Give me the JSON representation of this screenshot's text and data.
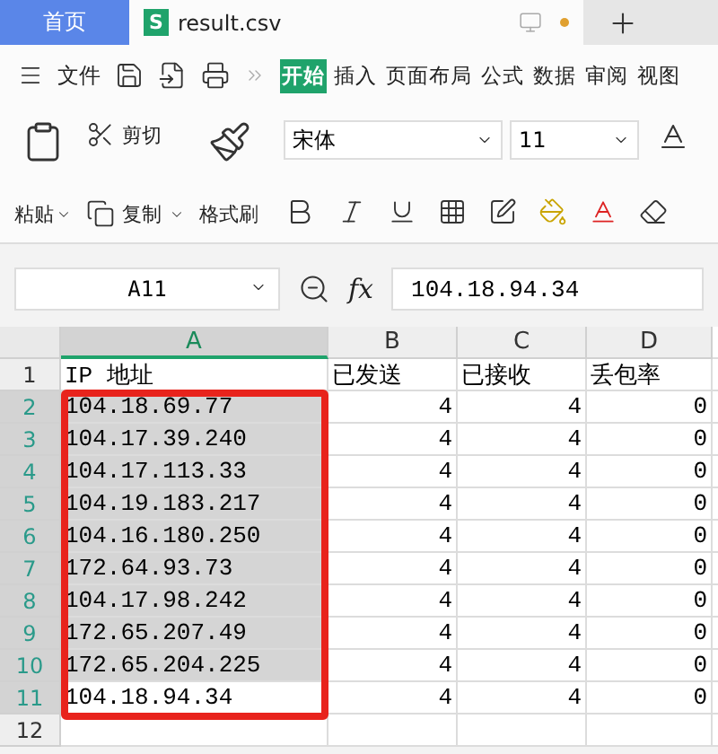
{
  "tabs": [
    {
      "kind": "home",
      "label": "首页",
      "selected": false
    },
    {
      "kind": "file",
      "label": "result.csv",
      "badge": "S",
      "selected": true
    }
  ],
  "menu": {
    "file_label": "文件",
    "items": [
      {
        "label": "开始",
        "selected": true
      },
      {
        "label": "插入",
        "selected": false
      },
      {
        "label": "页面布局",
        "selected": false
      },
      {
        "label": "公式",
        "selected": false
      },
      {
        "label": "数据",
        "selected": false
      },
      {
        "label": "审阅",
        "selected": false
      },
      {
        "label": "视图",
        "selected": false
      }
    ]
  },
  "ribbon": {
    "cut": "剪切",
    "paste": "粘贴",
    "copy": "复制",
    "format_painter": "格式刷",
    "font": "宋体",
    "size": "11"
  },
  "formula_bar": {
    "name_box": "A11",
    "fx": "fx",
    "formula": "104.18.94.34"
  },
  "columns": [
    {
      "label": "A",
      "selected": true
    },
    {
      "label": "B",
      "selected": false
    },
    {
      "label": "C",
      "selected": false
    },
    {
      "label": "D",
      "selected": false
    }
  ],
  "rows": [
    {
      "label": "1",
      "selected": false,
      "cells": [
        "IP 地址",
        "已发送",
        "已接收",
        "丢包率"
      ]
    },
    {
      "label": "2",
      "selected": true,
      "cells": [
        "104.18.69.77",
        "4",
        "4",
        "0"
      ]
    },
    {
      "label": "3",
      "selected": true,
      "cells": [
        "104.17.39.240",
        "4",
        "4",
        "0"
      ]
    },
    {
      "label": "4",
      "selected": true,
      "cells": [
        "104.17.113.33",
        "4",
        "4",
        "0"
      ]
    },
    {
      "label": "5",
      "selected": true,
      "cells": [
        "104.19.183.217",
        "4",
        "4",
        "0"
      ]
    },
    {
      "label": "6",
      "selected": true,
      "cells": [
        "104.16.180.250",
        "4",
        "4",
        "0"
      ]
    },
    {
      "label": "7",
      "selected": true,
      "cells": [
        "172.64.93.73",
        "4",
        "4",
        "0"
      ]
    },
    {
      "label": "8",
      "selected": true,
      "cells": [
        "104.17.98.242",
        "4",
        "4",
        "0"
      ]
    },
    {
      "label": "9",
      "selected": true,
      "cells": [
        "172.65.207.49",
        "4",
        "4",
        "0"
      ]
    },
    {
      "label": "10",
      "selected": true,
      "cells": [
        "172.65.204.225",
        "4",
        "4",
        "0"
      ]
    },
    {
      "label": "11",
      "selected": true,
      "active": true,
      "cells": [
        "104.18.94.34",
        "4",
        "4",
        "0"
      ]
    },
    {
      "label": "12",
      "selected": false
    }
  ],
  "annotation": {
    "kind": "red-box"
  }
}
